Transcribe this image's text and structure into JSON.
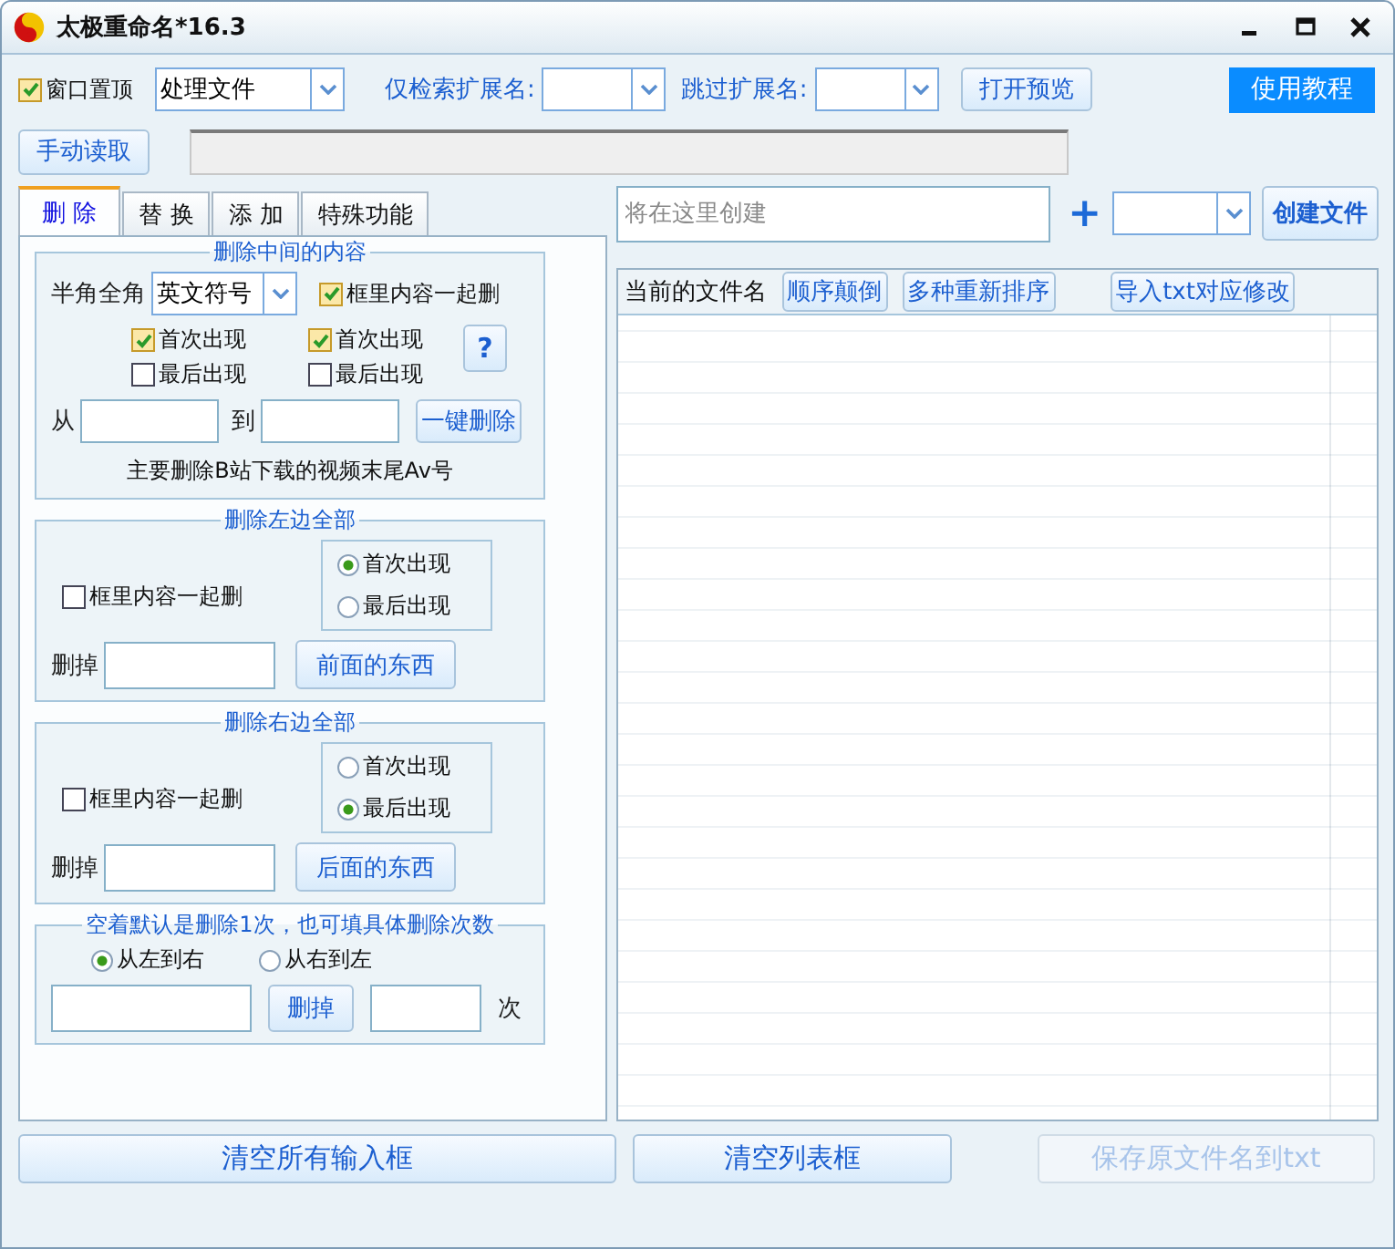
{
  "window": {
    "title": "太极重命名*16.3"
  },
  "toolbar": {
    "always_on_top": {
      "label": "窗口置顶",
      "checked": true
    },
    "mode": {
      "value": "处理文件"
    },
    "search_ext": {
      "label": "仅检索扩展名:"
    },
    "skip_ext": {
      "label": "跳过扩展名:"
    },
    "preview_button": "打开预览",
    "tutorial_button": "使用教程"
  },
  "read_button": "手动读取",
  "tabs": [
    {
      "label": "删 除",
      "selected": true
    },
    {
      "label": "替 换",
      "selected": false
    },
    {
      "label": "添 加",
      "selected": false
    },
    {
      "label": "特殊功能",
      "selected": false
    }
  ],
  "delete_middle": {
    "title": "删除中间的内容",
    "width_label": "半角全角",
    "width_value": "英文符号",
    "include_brackets": {
      "label": "框里内容一起删",
      "checked": true
    },
    "start_options": [
      {
        "label": "首次出现",
        "checked": true
      },
      {
        "label": "最后出现",
        "checked": false
      }
    ],
    "end_options": [
      {
        "label": "首次出现",
        "checked": true
      },
      {
        "label": "最后出现",
        "checked": false
      }
    ],
    "help_button": "?",
    "from_label": "从",
    "to_label": "到",
    "delete_button": "一键删除",
    "note": "主要删除B站下载的视频末尾Av号"
  },
  "delete_left": {
    "title": "删除左边全部",
    "include_brackets": {
      "label": "框里内容一起删",
      "checked": false
    },
    "occurrence": [
      {
        "label": "首次出现",
        "selected": true
      },
      {
        "label": "最后出现",
        "selected": false
      }
    ],
    "delete_label": "删掉",
    "button": "前面的东西"
  },
  "delete_right": {
    "title": "删除右边全部",
    "include_brackets": {
      "label": "框里内容一起删",
      "checked": false
    },
    "occurrence": [
      {
        "label": "首次出现",
        "selected": false
      },
      {
        "label": "最后出现",
        "selected": true
      }
    ],
    "delete_label": "删掉",
    "button": "后面的东西"
  },
  "count_section": {
    "title": "空着默认是删除1次，也可填具体删除次数",
    "direction": [
      {
        "label": "从左到右",
        "selected": true
      },
      {
        "label": "从右到左",
        "selected": false
      }
    ],
    "delete_button": "删掉",
    "times_label": "次"
  },
  "create": {
    "placeholder": "将在这里创建",
    "plus": "+",
    "button": "创建文件"
  },
  "file_list": {
    "header": "当前的文件名",
    "buttons": [
      "顺序颠倒",
      "多种重新排序",
      "导入txt对应修改"
    ]
  },
  "bottom_buttons": [
    {
      "label": "清空所有输入框",
      "disabled": false
    },
    {
      "label": "清空列表框",
      "disabled": false
    },
    {
      "label": "保存原文件名到txt",
      "disabled": true
    }
  ]
}
